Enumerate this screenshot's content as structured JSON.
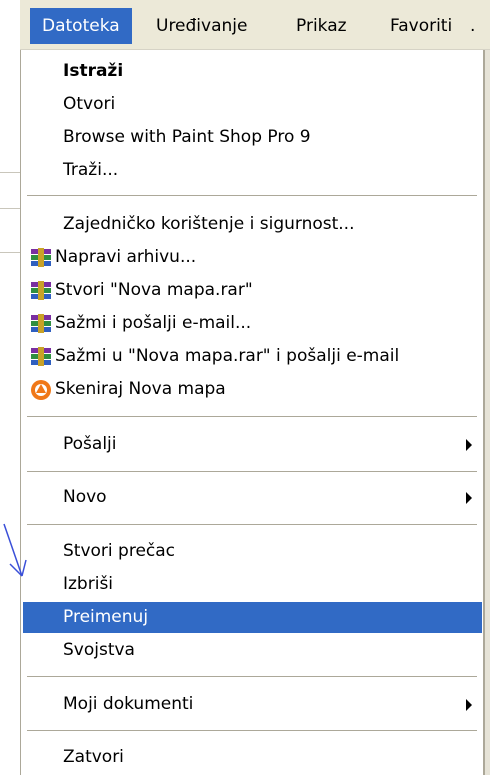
{
  "menubar": {
    "items": [
      {
        "label": "Datoteka",
        "active": true
      },
      {
        "label": "Uređivanje"
      },
      {
        "label": "Prikaz"
      },
      {
        "label": "Favoriti"
      },
      {
        "label": "."
      }
    ]
  },
  "menu": {
    "items": [
      {
        "label": "Istraži",
        "bold": true
      },
      {
        "label": "Otvori"
      },
      {
        "label": "Browse with Paint Shop Pro 9"
      },
      {
        "label": "Traži..."
      },
      {
        "label": "Zajedničko korištenje i sigurnost..."
      },
      {
        "label": "Napravi arhivu...",
        "icon": "winrar-icon"
      },
      {
        "label": "Stvori \"Nova mapa.rar\"",
        "icon": "winrar-icon"
      },
      {
        "label": "Sažmi i pošalji e-mail...",
        "icon": "winrar-icon"
      },
      {
        "label": "Sažmi u \"Nova mapa.rar\" i pošalji e-mail",
        "icon": "winrar-icon"
      },
      {
        "label": "Skeniraj Nova mapa",
        "icon": "avast-icon"
      },
      {
        "label": "Pošalji",
        "submenu": true
      },
      {
        "label": "Novo",
        "submenu": true
      },
      {
        "label": "Stvori prečac"
      },
      {
        "label": "Izbriši"
      },
      {
        "label": "Preimenuj",
        "highlighted": true
      },
      {
        "label": "Svojstva"
      },
      {
        "label": "Moji dokumenti",
        "submenu": true
      },
      {
        "label": "Zatvori"
      }
    ]
  },
  "colors": {
    "highlight": "#316ac5",
    "menubar_bg": "#ece9d8",
    "separator": "#aca899",
    "callout_arrow": "#3a4fd8"
  }
}
